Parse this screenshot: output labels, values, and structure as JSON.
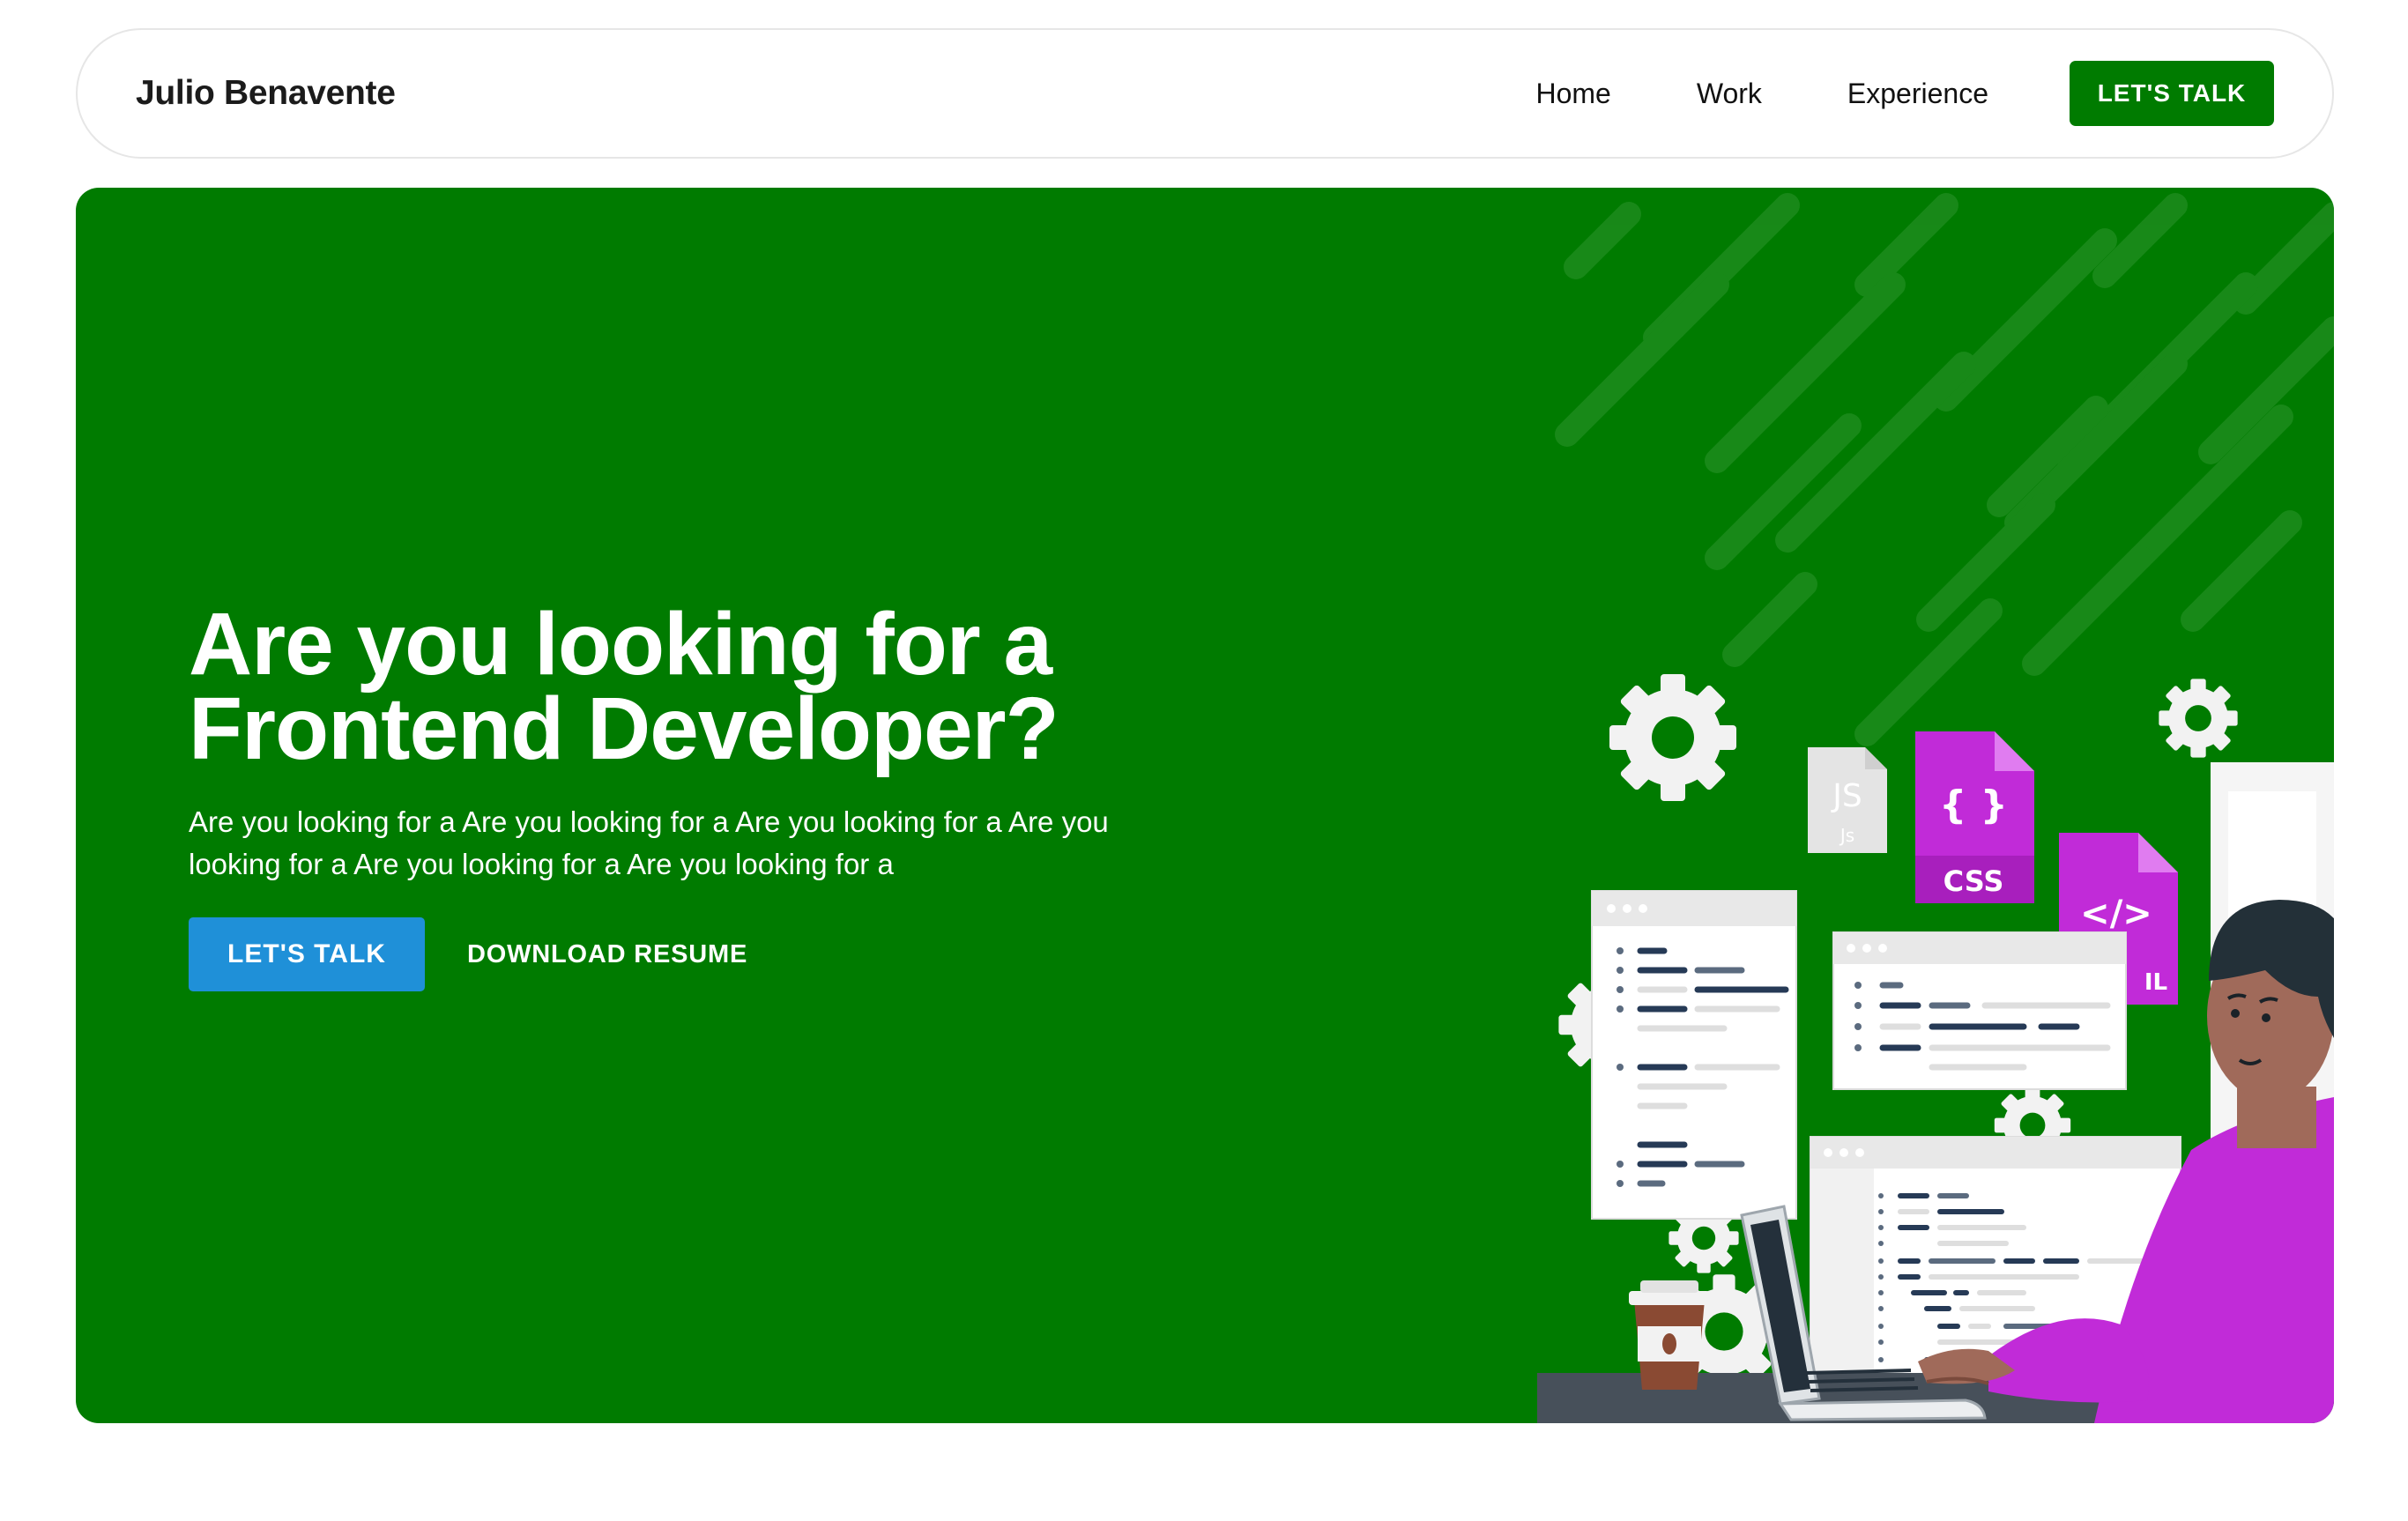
{
  "nav": {
    "brand": "Julio Benavente",
    "links": [
      "Home",
      "Work",
      "Experience"
    ],
    "cta": "LET'S TALK"
  },
  "hero": {
    "title_line1": "Are you looking for a",
    "title_line2": "Frontend Developer?",
    "description": "Are you looking for a Are you looking for a Are you looking for a Are you looking for a Are you looking for a Are you looking for a",
    "primary_cta": "LET'S TALK",
    "secondary_cta": "DOWNLOAD RESUME"
  },
  "illustration": {
    "file_labels": {
      "js": "JS",
      "js_small": "Js",
      "css_symbol": "{ }",
      "css": "CSS",
      "html_symbol": "</>",
      "html_partial": "IL"
    }
  },
  "colors": {
    "brand_green": "#007b00",
    "button_blue": "#1f90d8",
    "accent_magenta": "#c12bd8"
  }
}
